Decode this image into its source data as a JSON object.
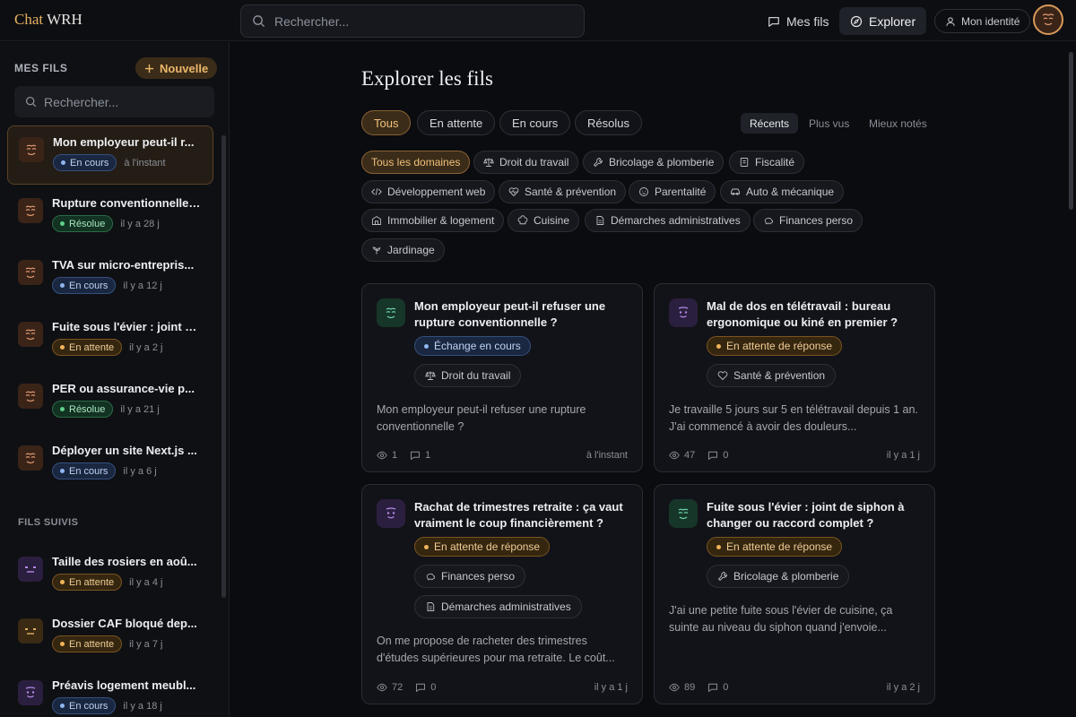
{
  "app": {
    "logo_a": "Chat",
    "logo_b": "WRH"
  },
  "top": {
    "search_placeholder": "Rechercher...",
    "nav_fils": "Mes fils",
    "nav_explorer": "Explorer",
    "identity": "Mon identité"
  },
  "sidebar": {
    "heading": "MES FILS",
    "new_label": "Nouvelle",
    "search_placeholder": "Rechercher...",
    "follow_heading": "FILS SUIVIS",
    "threads": [
      {
        "title": "Mon employeur peut-il r...",
        "status": "En cours",
        "time": "à l'instant"
      },
      {
        "title": "Rupture conventionnelle ...",
        "status": "Résolue",
        "time": "il y a 28 j"
      },
      {
        "title": "TVA sur micro-entrepris...",
        "status": "En cours",
        "time": "il y a 12 j"
      },
      {
        "title": "Fuite sous l'évier : joint d...",
        "status": "En attente",
        "time": "il y a 2 j"
      },
      {
        "title": "PER ou assurance-vie p...",
        "status": "Résolue",
        "time": "il y a 21 j"
      },
      {
        "title": "Déployer un site Next.js ...",
        "status": "En cours",
        "time": "il y a 6 j"
      }
    ],
    "followed": [
      {
        "title": "Taille des rosiers en aoû...",
        "status": "En attente",
        "time": "il y a 4 j"
      },
      {
        "title": "Dossier CAF bloqué dep...",
        "status": "En attente",
        "time": "il y a 7 j"
      },
      {
        "title": "Préavis logement meubl...",
        "status": "En cours",
        "time": "il y a 18 j"
      }
    ]
  },
  "main": {
    "title": "Explorer les fils",
    "filters": [
      "Tous",
      "En attente",
      "En cours",
      "Résolus"
    ],
    "sorts": [
      "Récents",
      "Plus vus",
      "Mieux notés"
    ],
    "domains": [
      "Tous les domaines",
      "Droit du travail",
      "Bricolage & plomberie",
      "Fiscalité",
      "Développement web",
      "Santé & prévention",
      "Parentalité",
      "Auto & mécanique",
      "Immobilier & logement",
      "Cuisine",
      "Démarches administratives",
      "Finances perso",
      "Jardinage"
    ],
    "cards": [
      {
        "title": "Mon employeur peut-il refuser une rupture conventionnelle ?",
        "status": "Échange en cours",
        "domains": [
          "Droit du travail"
        ],
        "desc": "Mon employeur peut-il refuser une rupture conventionnelle ?",
        "views": "1",
        "comments": "1",
        "time": "à l'instant"
      },
      {
        "title": "Mal de dos en télétravail : bureau ergonomique ou kiné en premier ?",
        "status": "En attente de réponse",
        "domains": [
          "Santé & prévention"
        ],
        "desc": "Je travaille 5 jours sur 5 en télétravail depuis 1 an. J'ai commencé à avoir des douleurs...",
        "views": "47",
        "comments": "0",
        "time": "il y a 1 j"
      },
      {
        "title": "Rachat de trimestres retraite : ça vaut vraiment le coup financièrement ?",
        "status": "En attente de réponse",
        "domains": [
          "Finances perso",
          "Démarches administratives"
        ],
        "desc": "On me propose de racheter des trimestres d'études supérieures pour ma retraite. Le coût...",
        "views": "72",
        "comments": "0",
        "time": "il y a 1 j"
      },
      {
        "title": "Fuite sous l'évier : joint de siphon à changer ou raccord complet ?",
        "status": "En attente de réponse",
        "domains": [
          "Bricolage & plomberie"
        ],
        "desc": "J'ai une petite fuite sous l'évier de cuisine, ça suinte au niveau du siphon quand j'envoie...",
        "views": "89",
        "comments": "0",
        "time": "il y a 2 j"
      }
    ]
  },
  "colors": {
    "accent": "#e6b15f",
    "bg": "#0b0c10",
    "card": "#121318"
  }
}
